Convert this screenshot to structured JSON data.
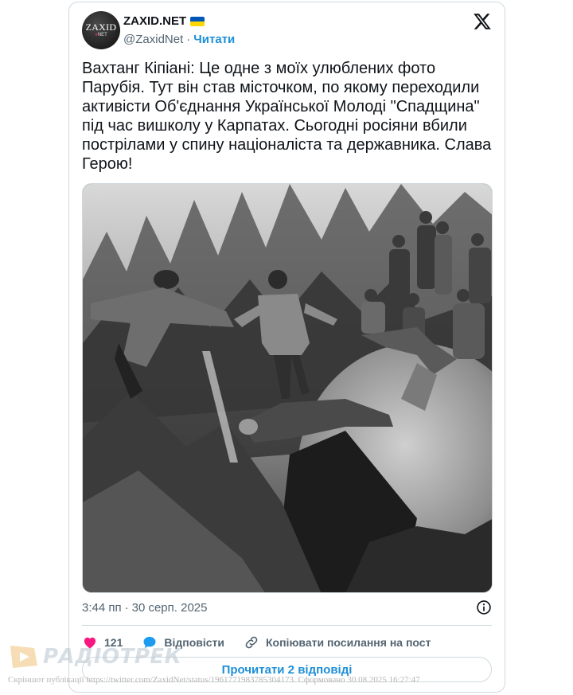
{
  "tweet": {
    "avatar_line1": "ZAXID",
    "avatar_line2": "NET",
    "name": "ZAXID.NET",
    "handle": "@ZaxidNet",
    "separator": "·",
    "follow_label": "Читати",
    "text": "Вахтанг Кіпіані: Це одне з моїх улюблених фото Парубія. Тут він став місточком, по якому переходили активісти Об'єднання Української Молоді \"Спадщина\" під час вишколу у Карпатах. Сьогодні росіяни вбили пострілами у спину націоналіста та державника. Слава Герою!",
    "time": "3:44 пп",
    "date": "30 серп. 2025",
    "likes_count": "121",
    "reply_label": "Відповісти",
    "copy_link_label": "Копіювати посилання на пост",
    "read_replies_label": "Прочитати 2 відповіді"
  },
  "watermark": {
    "text": "РАДІОТРЕК"
  },
  "footer": {
    "text": "Скріншот публікації https://twitter.com/ZaxidNet/status/1961771983785304173. Сформовано 30.08.2025 16:27:47"
  },
  "colors": {
    "accent": "#1d9bf0",
    "like": "#f91880",
    "text": "#0f1419",
    "muted": "#536471",
    "border": "#cfd9de"
  },
  "icons": {
    "brand": "x-logo-icon",
    "info": "info-icon",
    "like": "heart-icon",
    "reply": "speech-bubble-icon",
    "copy": "link-icon"
  }
}
